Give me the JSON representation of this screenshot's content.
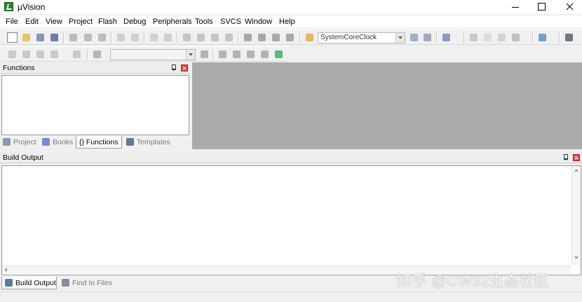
{
  "window": {
    "title": "µVision"
  },
  "menu": [
    "File",
    "Edit",
    "View",
    "Project",
    "Flash",
    "Debug",
    "Peripherals",
    "Tools",
    "SVCS",
    "Window",
    "Help"
  ],
  "toolbar": {
    "find_combo_value": "SystemCoreClock",
    "target_combo_value": "",
    "icons": [
      "new-file-icon",
      "open-folder-icon",
      "save-icon",
      "save-all-icon",
      "cut-icon",
      "copy-icon",
      "paste-icon",
      "undo-icon",
      "redo-icon",
      "nav-back-icon",
      "nav-forward-icon",
      "bookmark-icon",
      "prev-bookmark-icon",
      "next-bookmark-icon",
      "clear-bookmarks-icon",
      "indent-icon",
      "unindent-icon",
      "comment-icon",
      "uncomment-icon",
      "find-in-files-icon",
      "find-icon",
      "incremental-find-icon",
      "zoom-icon",
      "debug-session-icon",
      "breakpoint-icon",
      "disable-breakpoint-icon",
      "kill-breakpoints-icon",
      "window-layout-icon",
      "configure-icon"
    ]
  },
  "functions_panel": {
    "title": "Functions",
    "tabs": [
      {
        "label": "Project",
        "icon": "project-icon",
        "active": false
      },
      {
        "label": "Books",
        "icon": "books-icon",
        "active": false
      },
      {
        "label": "{} Functions",
        "icon": "functions-icon",
        "active": true
      },
      {
        "label": "Templates",
        "icon": "templates-icon",
        "active": false
      }
    ]
  },
  "build_output": {
    "title": "Build Output",
    "tabs": [
      {
        "label": "Build Output",
        "icon": "build-output-icon",
        "active": true
      },
      {
        "label": "Find In Files",
        "icon": "find-in-files-tab-icon",
        "active": false
      }
    ]
  },
  "watermark": "知乎 @CW32生态社区",
  "colors": {
    "editor_background": "#ababab",
    "titlebar": "#ffffff",
    "close_button": "#e04848"
  }
}
